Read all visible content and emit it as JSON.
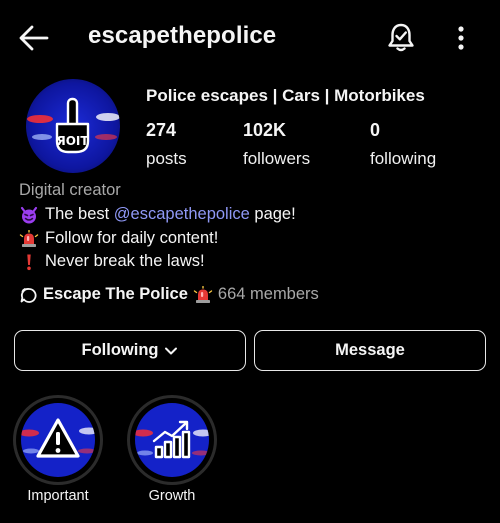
{
  "header": {
    "username": "escapethepolice",
    "back_icon": "arrow-left-icon",
    "notification_icon": "bell-icon",
    "menu_icon": "more-vertical-icon"
  },
  "profile": {
    "name": "Police escapes | Cars | Motorbikes",
    "stats": {
      "posts": {
        "value": "274",
        "label": "posts"
      },
      "followers": {
        "value": "102K",
        "label": "followers"
      },
      "following": {
        "value": "0",
        "label": "following"
      }
    },
    "category": "Digital creator",
    "bio": {
      "line1_prefix": "The best ",
      "line1_mention": "@escapethepolice",
      "line1_suffix": " page!",
      "line2": "Follow for daily content!",
      "line3": "Never break the laws!"
    },
    "channel": {
      "name": "Escape The Police",
      "members": "664 members"
    }
  },
  "actions": {
    "following_label": "Following",
    "message_label": "Message"
  },
  "highlights": [
    {
      "label": "Important",
      "icon": "warning-icon"
    },
    {
      "label": "Growth",
      "icon": "growth-chart-icon"
    }
  ],
  "colors": {
    "background": "#000000",
    "mention": "#8f98f5",
    "muted": "#a8a8a8"
  }
}
